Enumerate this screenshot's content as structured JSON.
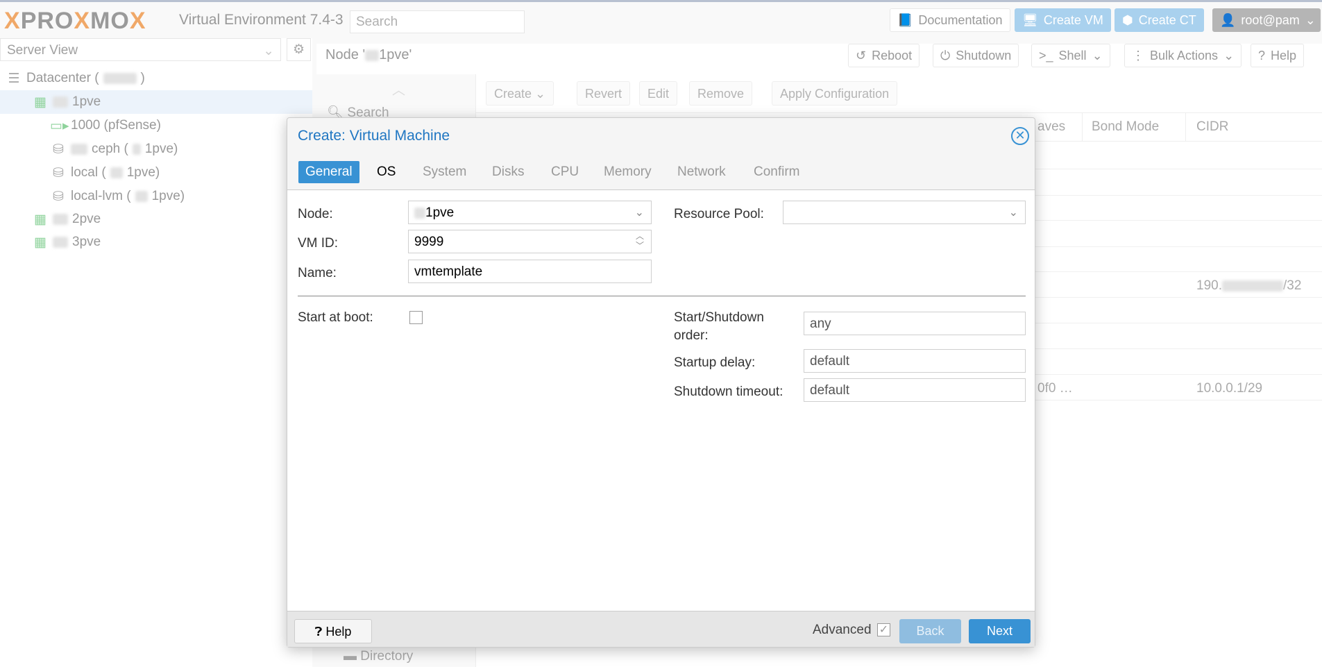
{
  "topbar": {
    "logo": "PROXMOX",
    "version": "Virtual Environment 7.4-3",
    "search_placeholder": "Search",
    "documentation": "Documentation",
    "create_vm": "Create VM",
    "create_ct": "Create CT",
    "user": "root@pam"
  },
  "sidebar": {
    "view": "Server View",
    "items": [
      {
        "label": "Datacenter (",
        "suffix": ")",
        "icon": "datacenter-icon"
      },
      {
        "label": "1pve",
        "icon": "node-online-icon"
      },
      {
        "label": "1000 (pfSense)",
        "icon": "vm-running-icon"
      },
      {
        "label": "ceph (",
        "suffix": "1pve)",
        "icon": "storage-icon"
      },
      {
        "label": "local (",
        "suffix": "1pve)",
        "icon": "storage-icon"
      },
      {
        "label": "local-lvm (",
        "suffix": "1pve)",
        "icon": "storage-icon"
      },
      {
        "label": "2pve",
        "icon": "node-online-icon"
      },
      {
        "label": "3pve",
        "icon": "node-online-icon"
      }
    ]
  },
  "node": {
    "title_prefix": "Node '",
    "title_suffix": "1pve'",
    "reboot": "Reboot",
    "shutdown": "Shutdown",
    "shell": "Shell",
    "bulk": "Bulk Actions",
    "help": "Help"
  },
  "nav": {
    "search": "Search",
    "directory": "Directory"
  },
  "network_toolbar": {
    "create": "Create",
    "revert": "Revert",
    "edit": "Edit",
    "remove": "Remove",
    "apply": "Apply Configuration"
  },
  "grid": {
    "columns": [
      "aves",
      "Bond Mode",
      "CIDR"
    ],
    "rows": [
      {
        "cidr_prefix": "190.",
        "cidr_suffix": "/32"
      },
      {
        "slaves": "0f0 …",
        "cidr": "10.0.0.1/29"
      }
    ]
  },
  "dialog": {
    "title": "Create: Virtual Machine",
    "tabs": [
      "General",
      "OS",
      "System",
      "Disks",
      "CPU",
      "Memory",
      "Network",
      "Confirm"
    ],
    "node_label": "Node:",
    "node_value": "1pve",
    "vmid_label": "VM ID:",
    "vmid_value": "9999",
    "name_label": "Name:",
    "name_value": "vmtemplate",
    "pool_label": "Resource Pool:",
    "pool_value": "",
    "boot_label": "Start at boot:",
    "boot_checked": false,
    "order_label": "Start/Shutdown order:",
    "order_value": "any",
    "delay_label": "Startup delay:",
    "delay_value": "default",
    "timeout_label": "Shutdown timeout:",
    "timeout_value": "default",
    "help": "Help",
    "advanced": "Advanced",
    "advanced_checked": true,
    "back": "Back",
    "next": "Next"
  },
  "colors": {
    "accent": "#3892d4",
    "title": "#1f76c2"
  }
}
